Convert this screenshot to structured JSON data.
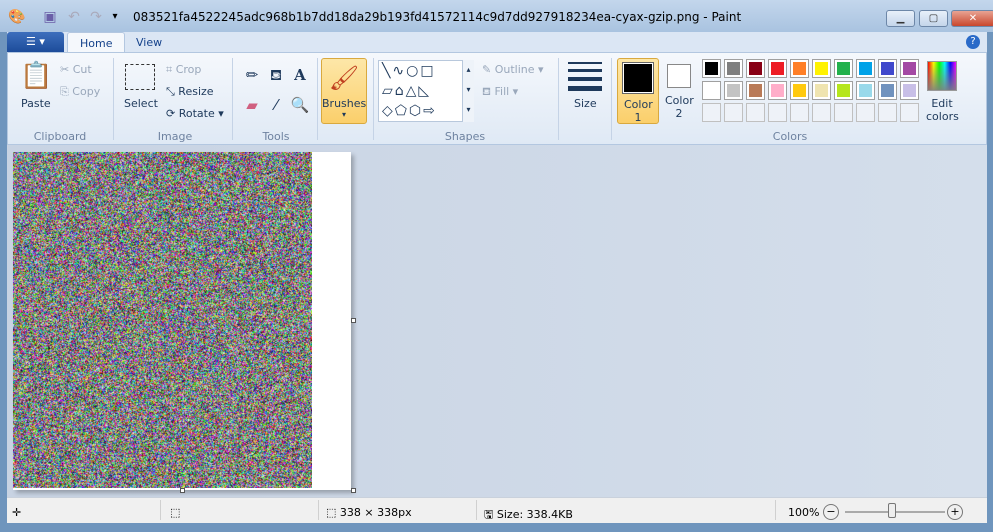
{
  "window": {
    "title": "083521fa4522245adc968b1b7dd18da29b193fd41572114c9d7dd927918234ea-cyax-gzip.png - Paint"
  },
  "tabs": [
    {
      "label": "Home"
    },
    {
      "label": "View"
    }
  ],
  "clipboard": {
    "paste": "Paste",
    "cut": "Cut",
    "copy": "Copy",
    "group": "Clipboard"
  },
  "image": {
    "select": "Select",
    "crop": "Crop",
    "resize": "Resize",
    "rotate": "Rotate",
    "group": "Image"
  },
  "tools": {
    "group": "Tools"
  },
  "brushes": {
    "label": "Brushes"
  },
  "shapes": {
    "outline": "Outline",
    "fill": "Fill",
    "group": "Shapes"
  },
  "size": {
    "label": "Size"
  },
  "colors": {
    "color1": "Color 1",
    "color2": "Color 2",
    "edit": "Edit colors",
    "group": "Colors",
    "row1": [
      "#000000",
      "#7f7f7f",
      "#880015",
      "#ed1c24",
      "#ff7f27",
      "#fff200",
      "#22b14c",
      "#00a2e8",
      "#3f48cc",
      "#a349a4"
    ],
    "row2": [
      "#ffffff",
      "#c3c3c3",
      "#b97a57",
      "#ffaec9",
      "#ffc90e",
      "#efe4b0",
      "#b5e61d",
      "#99d9ea",
      "#7092be",
      "#c8bfe7"
    ]
  },
  "status": {
    "dimensions": "338 × 338px",
    "size": "Size: 338.4KB",
    "zoom": "100%"
  }
}
